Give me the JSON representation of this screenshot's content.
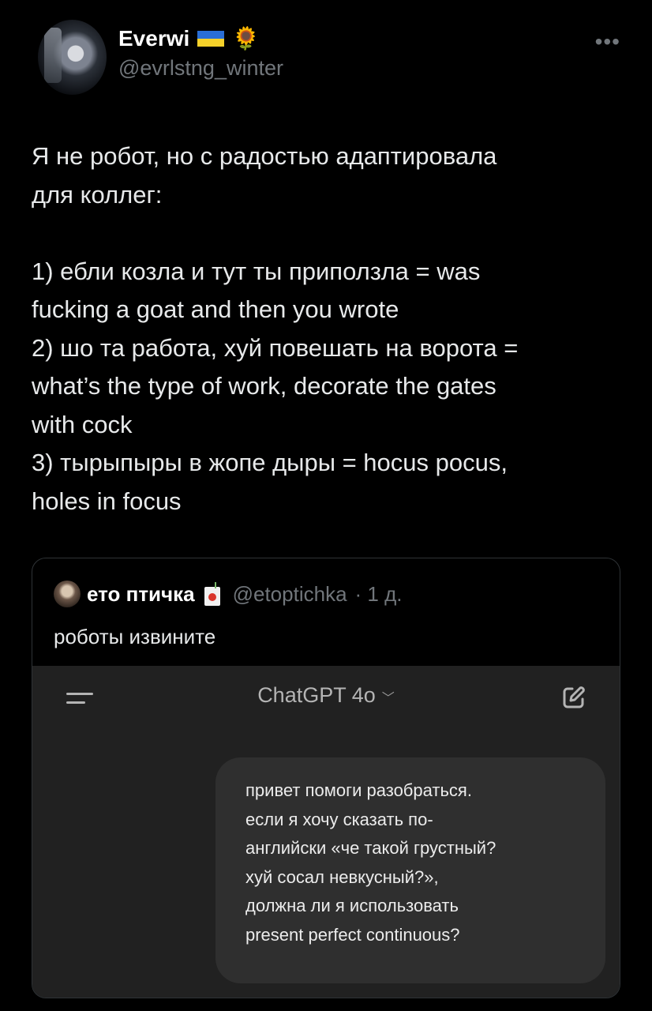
{
  "tweet": {
    "author_name": "Everwi",
    "handle": "@evrlstng_winter",
    "flag_icon": "ukraine-flag-icon",
    "emoji_icon": "sunflower-icon",
    "more_icon": "more-horizontal-icon",
    "text": "Я не робот, но с радостью адаптировала\nдля коллег:\n\n1) ебли козла и тут ты приползла = was\nfucking a goat and then you wrote\n2) шо та работа, хуй повешать на ворота =\nwhat’s the type of work, decorate the gates\nwith cock\n3) тырыпыры в жопе дыры = hocus pocus,\nholes in focus"
  },
  "quote": {
    "author_name": "ето птичка",
    "emoji_icon": "juice-box-icon",
    "handle": "@etoptichka",
    "time": "· 1 д.",
    "text": "роботы извините",
    "chat": {
      "model_label": "ChatGPT 4o",
      "menu_icon": "menu-icon",
      "edit_icon": "new-chat-icon",
      "message": "привет помоги разобраться.\nесли я хочу сказать по-\nанглийски «че такой грустный?\nхуй сосал невкусный?»,\nдолжна ли я использовать\npresent perfect continuous?"
    }
  },
  "colors": {
    "background": "#000000",
    "text": "#e7e9ea",
    "muted": "#71767b",
    "chat_bg": "#212121",
    "bubble_bg": "#2f2f2f"
  }
}
